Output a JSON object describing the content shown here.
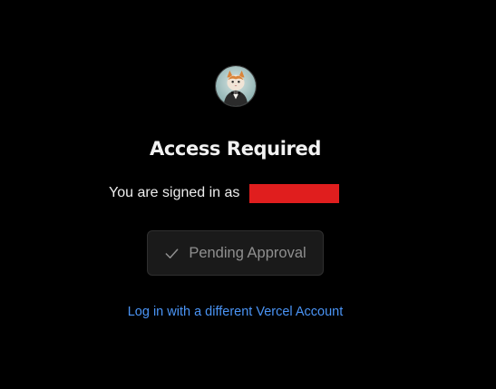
{
  "avatar": {
    "icon": "user-avatar-cat",
    "alt": ""
  },
  "header": {
    "title": "Access Required"
  },
  "account": {
    "signed_in_label": "You are signed in as",
    "redaction_color": "#e01e1e"
  },
  "status": {
    "label": "Pending Approval",
    "icon": "check-icon",
    "text_color": "#8f8f8f"
  },
  "links": {
    "alt_login": "Log in with a different Vercel Account",
    "color": "#4a94f5"
  }
}
